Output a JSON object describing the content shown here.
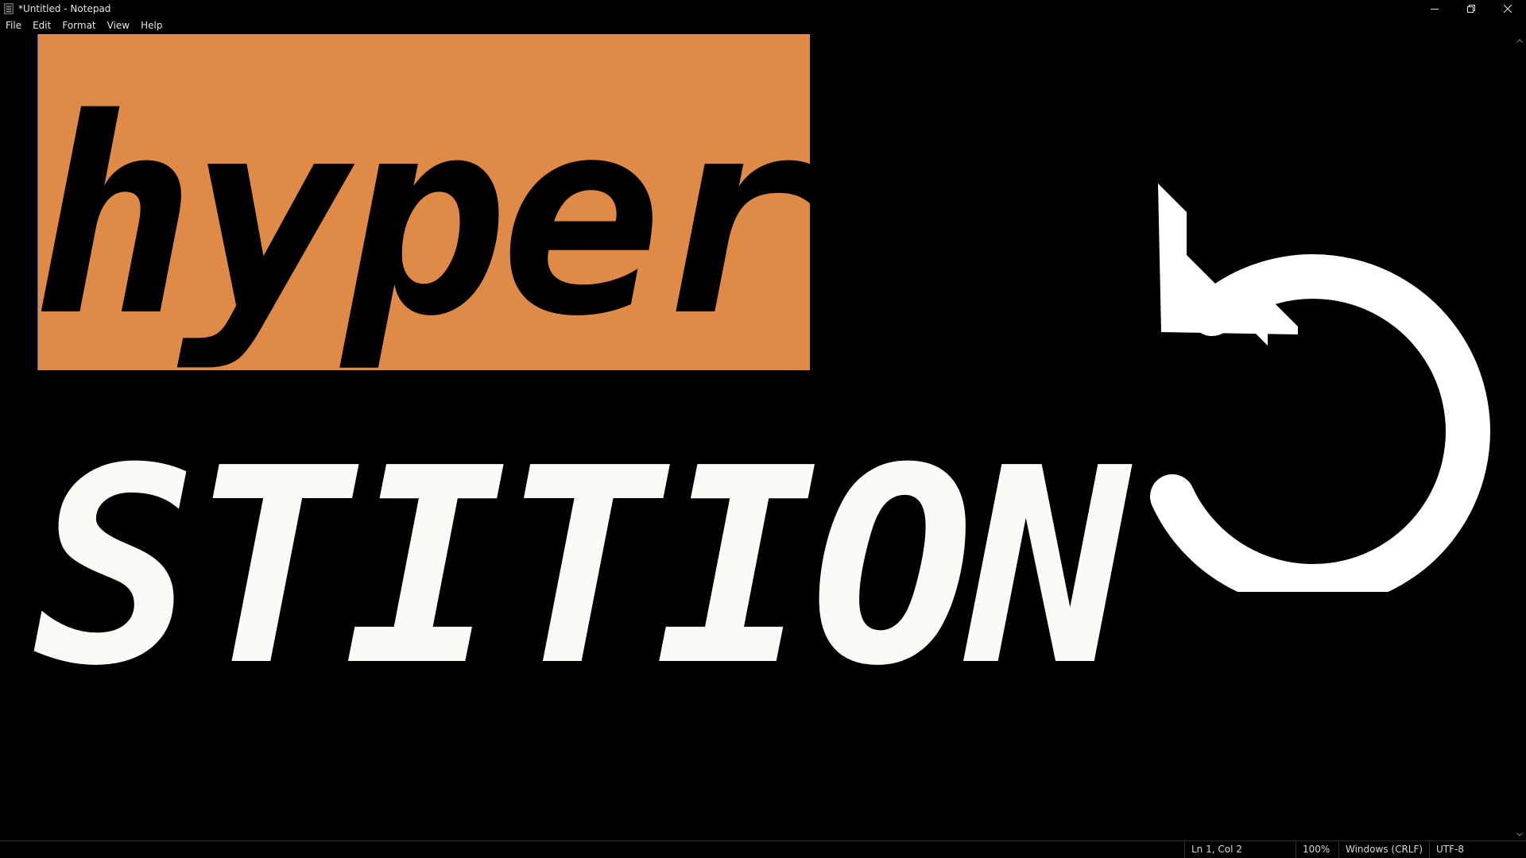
{
  "window": {
    "title": "*Untitled - Notepad"
  },
  "menu": {
    "items": [
      "File",
      "Edit",
      "Format",
      "View",
      "Help"
    ]
  },
  "editor": {
    "line1": "hyper",
    "line2": "STITION",
    "selection_color": "#e08a48",
    "text_color_line1": "#000000",
    "text_color_line2": "#fbfaf6",
    "graphic_icon": "undo-arrow-icon"
  },
  "status": {
    "position": "Ln 1, Col 2",
    "zoom": "100%",
    "line_ending": "Windows (CRLF)",
    "encoding": "UTF-8"
  },
  "colors": {
    "background": "#000000",
    "accent_caret": "#1e73d6"
  }
}
